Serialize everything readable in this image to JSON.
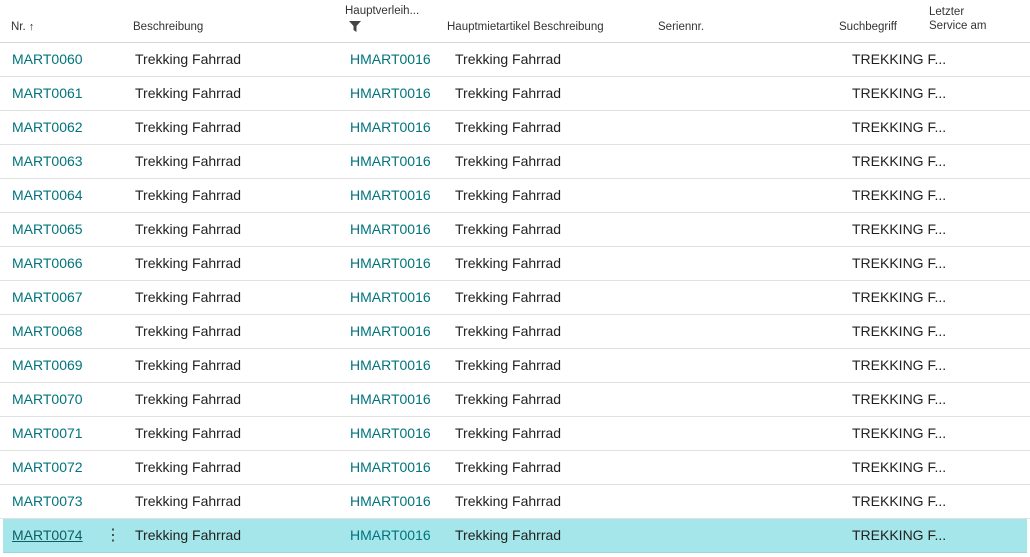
{
  "headers": {
    "nr": "Nr.",
    "nr_sort_icon": "sort-ascending-icon",
    "beschreibung": "Beschreibung",
    "hauptverleih": "Hauptverleih...",
    "hauptverleih_filter_icon": "filter-icon",
    "hauptmiet_beschreibung": "Hauptmietartikel Beschreibung",
    "seriennr": "Seriennr.",
    "suchbegriff": "Suchbegriff",
    "letzter_service_line1": "Letzter",
    "letzter_service_line2": "Service am"
  },
  "rows": [
    {
      "nr": "MART0060",
      "beschreibung": "Trekking Fahrrad",
      "hauptverleih": "HMART0016",
      "hauptmiet_beschreibung": "Trekking Fahrrad",
      "seriennr": "",
      "suchbegriff": "TREKKING F...",
      "letzter_service": ""
    },
    {
      "nr": "MART0061",
      "beschreibung": "Trekking Fahrrad",
      "hauptverleih": "HMART0016",
      "hauptmiet_beschreibung": "Trekking Fahrrad",
      "seriennr": "",
      "suchbegriff": "TREKKING F...",
      "letzter_service": ""
    },
    {
      "nr": "MART0062",
      "beschreibung": "Trekking Fahrrad",
      "hauptverleih": "HMART0016",
      "hauptmiet_beschreibung": "Trekking Fahrrad",
      "seriennr": "",
      "suchbegriff": "TREKKING F...",
      "letzter_service": ""
    },
    {
      "nr": "MART0063",
      "beschreibung": "Trekking Fahrrad",
      "hauptverleih": "HMART0016",
      "hauptmiet_beschreibung": "Trekking Fahrrad",
      "seriennr": "",
      "suchbegriff": "TREKKING F...",
      "letzter_service": ""
    },
    {
      "nr": "MART0064",
      "beschreibung": "Trekking Fahrrad",
      "hauptverleih": "HMART0016",
      "hauptmiet_beschreibung": "Trekking Fahrrad",
      "seriennr": "",
      "suchbegriff": "TREKKING F...",
      "letzter_service": ""
    },
    {
      "nr": "MART0065",
      "beschreibung": "Trekking Fahrrad",
      "hauptverleih": "HMART0016",
      "hauptmiet_beschreibung": "Trekking Fahrrad",
      "seriennr": "",
      "suchbegriff": "TREKKING F...",
      "letzter_service": ""
    },
    {
      "nr": "MART0066",
      "beschreibung": "Trekking Fahrrad",
      "hauptverleih": "HMART0016",
      "hauptmiet_beschreibung": "Trekking Fahrrad",
      "seriennr": "",
      "suchbegriff": "TREKKING F...",
      "letzter_service": ""
    },
    {
      "nr": "MART0067",
      "beschreibung": "Trekking Fahrrad",
      "hauptverleih": "HMART0016",
      "hauptmiet_beschreibung": "Trekking Fahrrad",
      "seriennr": "",
      "suchbegriff": "TREKKING F...",
      "letzter_service": ""
    },
    {
      "nr": "MART0068",
      "beschreibung": "Trekking Fahrrad",
      "hauptverleih": "HMART0016",
      "hauptmiet_beschreibung": "Trekking Fahrrad",
      "seriennr": "",
      "suchbegriff": "TREKKING F...",
      "letzter_service": ""
    },
    {
      "nr": "MART0069",
      "beschreibung": "Trekking Fahrrad",
      "hauptverleih": "HMART0016",
      "hauptmiet_beschreibung": "Trekking Fahrrad",
      "seriennr": "",
      "suchbegriff": "TREKKING F...",
      "letzter_service": ""
    },
    {
      "nr": "MART0070",
      "beschreibung": "Trekking Fahrrad",
      "hauptverleih": "HMART0016",
      "hauptmiet_beschreibung": "Trekking Fahrrad",
      "seriennr": "",
      "suchbegriff": "TREKKING F...",
      "letzter_service": ""
    },
    {
      "nr": "MART0071",
      "beschreibung": "Trekking Fahrrad",
      "hauptverleih": "HMART0016",
      "hauptmiet_beschreibung": "Trekking Fahrrad",
      "seriennr": "",
      "suchbegriff": "TREKKING F...",
      "letzter_service": ""
    },
    {
      "nr": "MART0072",
      "beschreibung": "Trekking Fahrrad",
      "hauptverleih": "HMART0016",
      "hauptmiet_beschreibung": "Trekking Fahrrad",
      "seriennr": "",
      "suchbegriff": "TREKKING F...",
      "letzter_service": ""
    },
    {
      "nr": "MART0073",
      "beschreibung": "Trekking Fahrrad",
      "hauptverleih": "HMART0016",
      "hauptmiet_beschreibung": "Trekking Fahrrad",
      "seriennr": "",
      "suchbegriff": "TREKKING F...",
      "letzter_service": ""
    },
    {
      "nr": "MART0074",
      "beschreibung": "Trekking Fahrrad",
      "hauptverleih": "HMART0016",
      "hauptmiet_beschreibung": "Trekking Fahrrad",
      "seriennr": "",
      "suchbegriff": "TREKKING F...",
      "letzter_service": "",
      "selected": true,
      "row_menu_icon": "more-vertical-icon",
      "row_menu_glyph": "⋮"
    }
  ],
  "colors": {
    "link": "#00737c",
    "selected_row": "#a5e6ea",
    "row_border": "#e1e1e1"
  }
}
